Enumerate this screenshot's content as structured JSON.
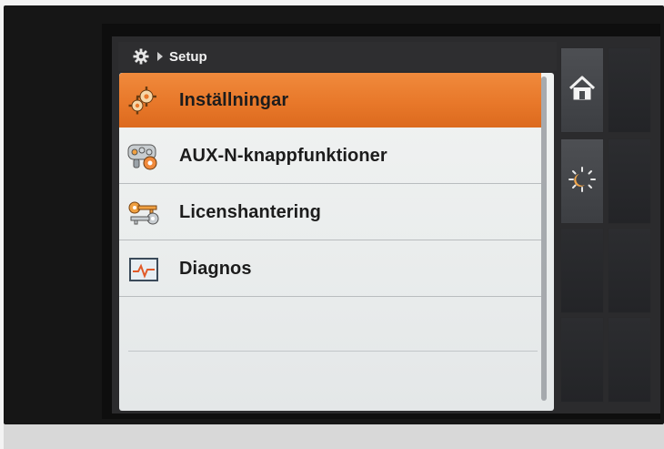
{
  "header": {
    "breadcrumb_icon": "gear-icon",
    "separator_icon": "caret-right-icon",
    "title": "Setup"
  },
  "menu": {
    "items": [
      {
        "label": "Inställningar",
        "icon": "gears-icon",
        "selected": true
      },
      {
        "label": "AUX-N-knappfunktioner",
        "icon": "aux-function-icon",
        "selected": false
      },
      {
        "label": "Licenshantering",
        "icon": "keys-icon",
        "selected": false
      },
      {
        "label": "Diagnos",
        "icon": "diagnosis-graph-icon",
        "selected": false
      }
    ]
  },
  "side_buttons": {
    "home_icon": "home-icon",
    "day_night_icon": "day-night-icon"
  },
  "colors": {
    "selected_row": "#e8782a",
    "screen_bg": "#2b2b2d",
    "panel_bg": "#eceeee"
  }
}
